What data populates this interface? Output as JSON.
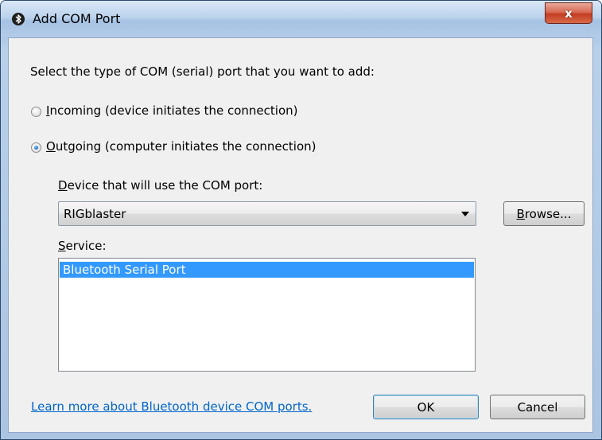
{
  "window": {
    "title": "Add COM Port",
    "title_icon": "bluetooth-icon"
  },
  "titlebar": {
    "close_glyph": "x"
  },
  "instruction": "Select the type of COM (serial) port that you want to add:",
  "radios": [
    {
      "hotkey": "I",
      "rest": "ncoming (device initiates the connection)",
      "selected": false
    },
    {
      "hotkey": "O",
      "rest": "utgoing (computer initiates the connection)",
      "selected": true
    }
  ],
  "device": {
    "label_hotkey": "D",
    "label_rest": "evice that will use the COM port:",
    "selected_value": "RIGblaster",
    "browse_hotkey": "B",
    "browse_rest": "rowse..."
  },
  "service": {
    "label_hotkey": "S",
    "label_rest": "ervice:",
    "items": [
      "Bluetooth Serial Port"
    ]
  },
  "footer": {
    "link": "Learn more about Bluetooth device COM ports.",
    "ok_label": "OK",
    "cancel_label": "Cancel"
  },
  "colors": {
    "selection": "#3399ff",
    "link": "#0066cc",
    "close_button": "#c33d23"
  }
}
